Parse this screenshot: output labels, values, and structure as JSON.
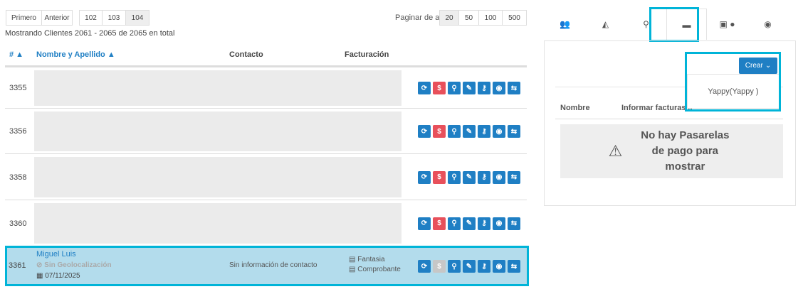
{
  "pagination": {
    "first": "Primero",
    "prev": "Anterior",
    "pages": [
      "102",
      "103",
      "104"
    ],
    "current": "104",
    "per_page_label": "Paginar de a",
    "per_page_options": [
      "20",
      "50",
      "100",
      "500"
    ],
    "per_page_selected": "20"
  },
  "summary": "Mostrando Clientes 2061 - 2065 de 2065 en total",
  "table": {
    "headers": {
      "id": "# ▲",
      "name": "Nombre y Apellido ▲",
      "contact": "Contacto",
      "billing": "Facturación"
    },
    "rows": [
      {
        "id": "3355"
      },
      {
        "id": "3356"
      },
      {
        "id": "3358"
      },
      {
        "id": "3360"
      }
    ],
    "selected": {
      "id": "3361",
      "name": "Miguel Luis",
      "geo": "Sin Geolocalización",
      "date": "07/11/2025",
      "contact": "Sin información de contacto",
      "billing1": "Fantasia",
      "billing2": "Comprobante"
    }
  },
  "actions": [
    "refresh-icon",
    "dollar-icon",
    "search-icon",
    "pencil-icon",
    "key-icon",
    "eye-icon",
    "transfer-icon"
  ],
  "colors": {
    "primary": "#1f7fc4",
    "danger": "#e8505b",
    "highlight": "#00b4d8",
    "selected_row": "#b3dcec"
  },
  "right_panel": {
    "tabs": [
      "users-icon",
      "chart-icon",
      "map-marker-icon",
      "credit-card-icon",
      "android-apple-icon",
      "eye-icon"
    ],
    "active_tab": 3,
    "create_label": "Crear",
    "dropdown_item": "Yappy(Yappy )",
    "col_name": "Nombre",
    "col_invoice": "Informar facturas a",
    "empty_message": "No hay Pasarelas de pago para mostrar"
  }
}
